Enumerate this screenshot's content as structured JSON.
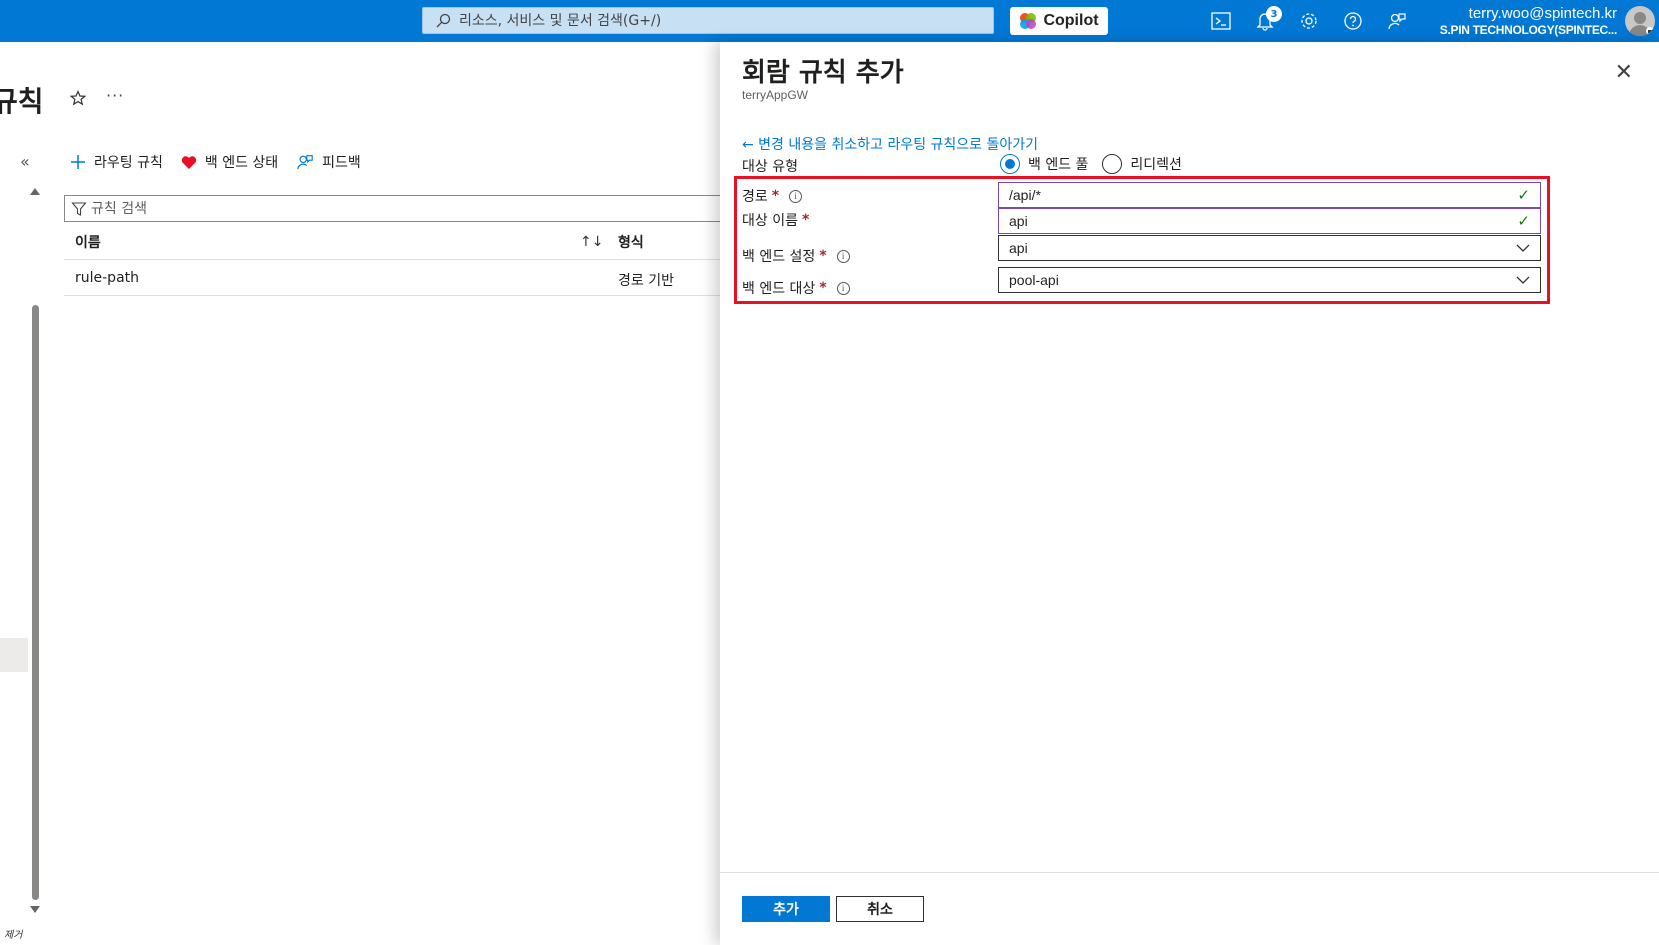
{
  "topbar": {
    "search_placeholder": "리소스, 서비스 및 문서 검색(G+/)",
    "copilot_label": "Copilot",
    "notification_count": "3",
    "user_email": "terry.woo@spintech.kr",
    "user_org": "S.PIN TECHNOLOGY(SPINTEC..."
  },
  "page": {
    "title": "규칙",
    "more": "···",
    "collapse": "«",
    "remove_label": "제거",
    "commands": {
      "routing_rule": "라우팅 규칙",
      "backend_health": "백 엔드 상태",
      "feedback": "피드백"
    },
    "filter_placeholder": "규칙 검색",
    "table": {
      "headers": [
        "이름",
        "형식"
      ],
      "rows": [
        {
          "name": "rule-path",
          "type": "경로 기반"
        }
      ]
    }
  },
  "panel": {
    "title": "회람 규칙 추가",
    "subtitle": "terryAppGW",
    "back_link": "← 변경 내용을 취소하고 라우팅 규칙으로 돌아가기",
    "target_type_label": "대상 유형",
    "target_options": [
      "백 엔드 풀",
      "리디렉션"
    ],
    "selected_target": "백 엔드 풀",
    "path_label": "경로",
    "path_value": "/api/*",
    "target_name_label": "대상 이름",
    "target_name_value": "api",
    "backend_setting_label": "백 엔드 설정",
    "backend_setting_value": "api",
    "backend_target_label": "백 엔드 대상",
    "backend_target_value": "pool-api",
    "add_button": "추가",
    "cancel_button": "취소"
  },
  "colors": {
    "accent": "#0078d4",
    "highlight": "#e81123",
    "valid": "#107c10"
  }
}
